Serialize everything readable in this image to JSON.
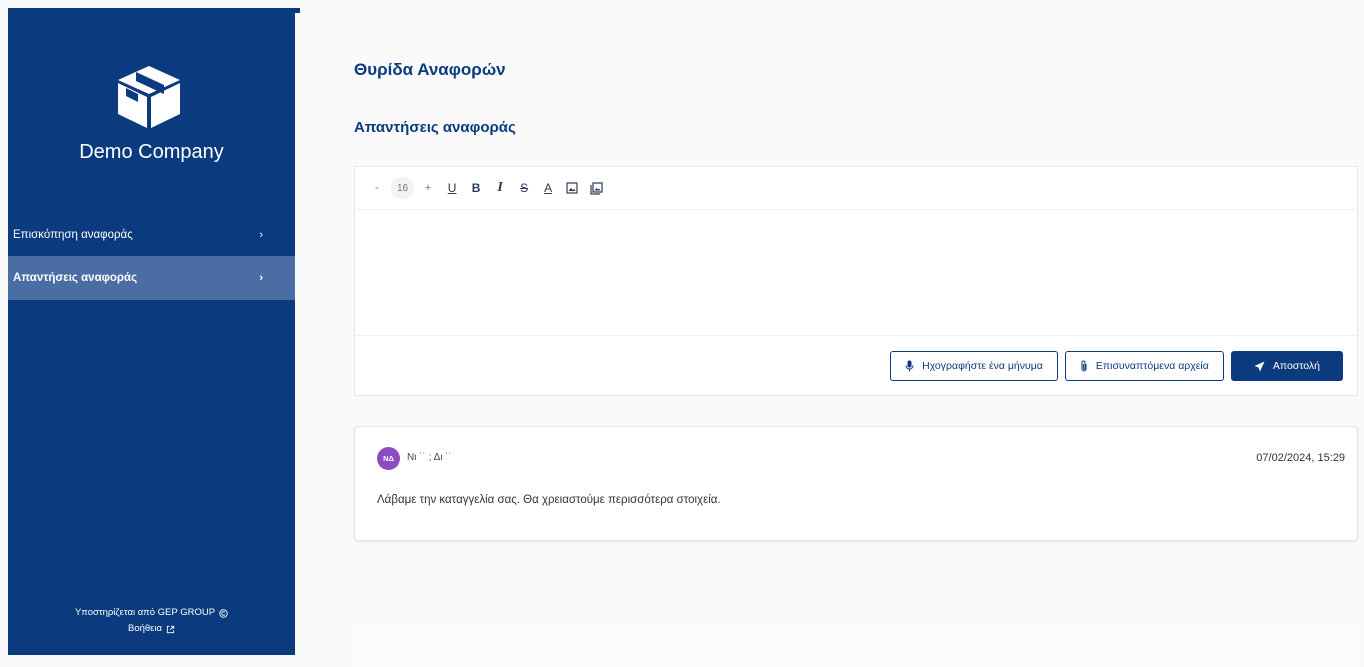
{
  "brand": {
    "company_name": "Demo Company",
    "accent_color": "#0b3b7e",
    "active_nav_color": "#4a6ea3",
    "avatar_color": "#8d4bc2"
  },
  "sidebar": {
    "items": [
      {
        "label": "Επισκόπηση αναφοράς",
        "icon": "chevron-right-icon",
        "active": false
      },
      {
        "label": "Απαντήσεις αναφοράς",
        "icon": "chevron-right-icon",
        "active": true
      }
    ],
    "footer": {
      "powered_by": "Υποστηρίζεται από GEP GROUP",
      "help": "Βοήθεια"
    }
  },
  "main": {
    "title": "Θυρίδα Αναφορών",
    "section_title": "Απαντήσεις αναφοράς"
  },
  "editor": {
    "toolbar": {
      "decrease": "-",
      "font_size": "16",
      "increase": "+",
      "underline": "U",
      "bold": "B",
      "italic": "I",
      "strike": "S",
      "text_color": "A"
    },
    "actions": {
      "record_label": "Ηχογραφήστε ένα μήνυμα",
      "attach_label": "Επισυναπτόμενα αρχεία",
      "send_label": "Αποστολή"
    }
  },
  "messages": [
    {
      "initials": "ΝΔ",
      "author": "Νι ˙˙ ; Δι ˙˙",
      "date": "07/02/2024, 15:29",
      "text": "Λάβαμε την καταγγελία σας. Θα χρειαστούμε περισσότερα στοιχεία."
    }
  ]
}
